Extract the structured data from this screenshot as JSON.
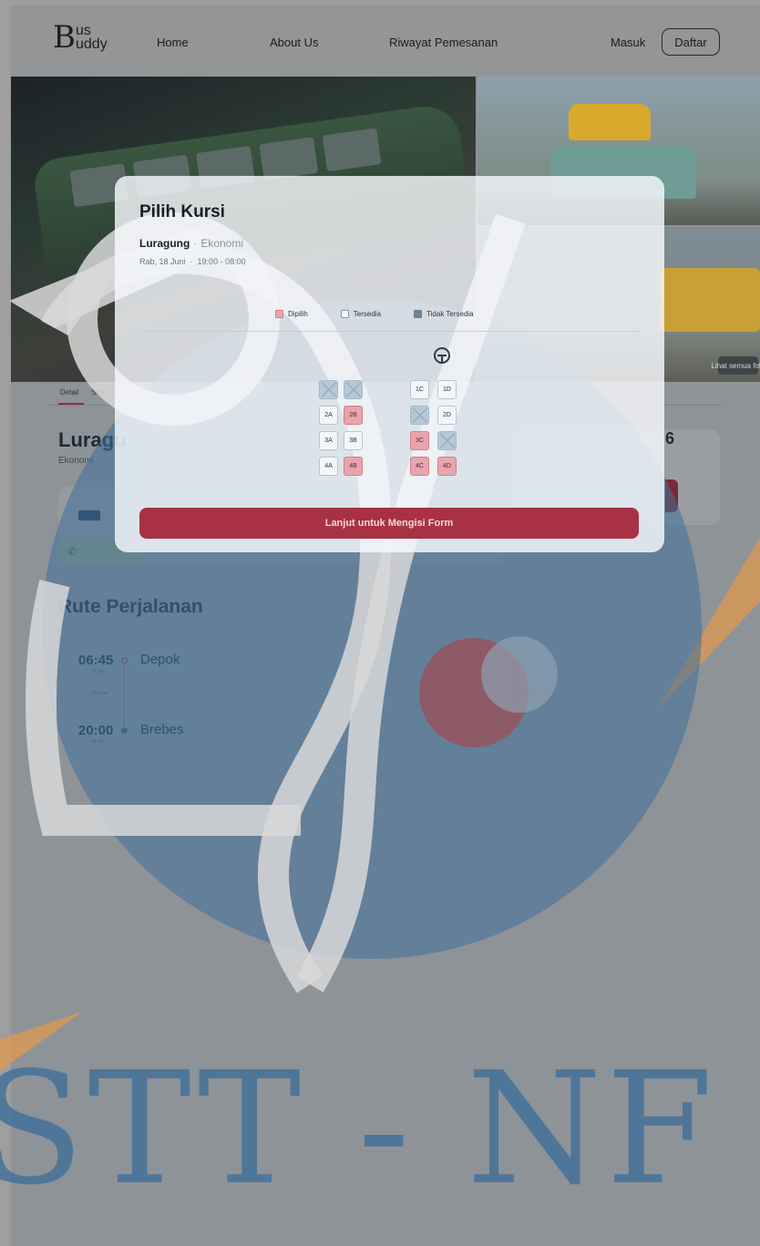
{
  "nav": {
    "logo_b": "B",
    "logo_top": "us",
    "logo_bottom": "uddy",
    "links": [
      "Home",
      "About Us",
      "Riwayat Pemesanan"
    ],
    "login": "Masuk",
    "register": "Daftar"
  },
  "hero": {
    "see_all": "Lihat semua foto"
  },
  "detail": {
    "tabs": [
      "Detail",
      "Sea"
    ],
    "title": "Luragu",
    "class": "Ekonomi",
    "price_partial": "6"
  },
  "route": {
    "title": "Rute Perjalanan",
    "depart_time": "06:45",
    "depart_city": "Depok",
    "depart_date": "18 Jun",
    "duration": "13j 15m",
    "arrive_time": "20:00",
    "arrive_city": "Brebes",
    "arrive_date": "18 Jun"
  },
  "modal": {
    "title": "Pilih Kursi",
    "operator": "Luragung",
    "class": "Ekonomi",
    "date": "Rab, 18 Juni",
    "time": "19:00 - 08:00",
    "legend": [
      {
        "label": "Dipilih",
        "color": "#e7a5ad"
      },
      {
        "label": "Tersedia",
        "color": "#f3f6f9"
      },
      {
        "label": "Tidak Tersedia",
        "color": "#8fa2b1"
      }
    ],
    "seats": [
      {
        "id": "1A",
        "label": "",
        "status": "unavailable"
      },
      {
        "id": "1B",
        "label": "",
        "status": "unavailable"
      },
      {
        "id": "1C",
        "label": "1C",
        "status": "available"
      },
      {
        "id": "1D",
        "label": "1D",
        "status": "available"
      },
      {
        "id": "2A",
        "label": "2A",
        "status": "available"
      },
      {
        "id": "2B",
        "label": "2B",
        "status": "selected"
      },
      {
        "id": "2C",
        "label": "",
        "status": "unavailable"
      },
      {
        "id": "2D",
        "label": "2D",
        "status": "available"
      },
      {
        "id": "3A",
        "label": "3A",
        "status": "available"
      },
      {
        "id": "3B",
        "label": "3B",
        "status": "available"
      },
      {
        "id": "3C",
        "label": "3C",
        "status": "selected"
      },
      {
        "id": "3D",
        "label": "",
        "status": "unavailable"
      },
      {
        "id": "4A",
        "label": "4A",
        "status": "available"
      },
      {
        "id": "4B",
        "label": "4B",
        "status": "selected"
      },
      {
        "id": "4C",
        "label": "4C",
        "status": "selected"
      },
      {
        "id": "4D",
        "label": "4D",
        "status": "selected"
      }
    ],
    "continue_label": "Lanjut untuk Mengisi Form"
  },
  "watermark": {
    "text": "STT - NF",
    "blue": "#3f6f9a",
    "orange": "#e59a4a"
  },
  "colors": {
    "accent": "#a83244",
    "selected": "#e7a5ad",
    "unavailable": "#8fa2b1"
  }
}
